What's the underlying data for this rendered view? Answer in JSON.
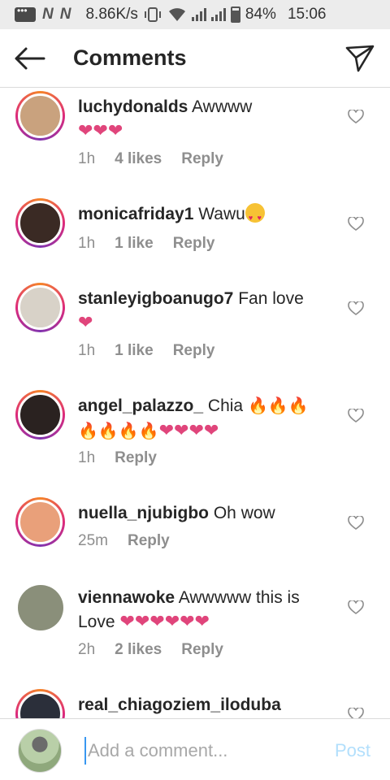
{
  "status_bar": {
    "n1": "N",
    "n2": "N",
    "speed": "8.86K/s",
    "battery": "84%",
    "time": "15:06"
  },
  "header": {
    "title": "Comments",
    "back_icon": "arrow-left-icon",
    "send_icon": "paper-plane-icon"
  },
  "comments": [
    {
      "username": "luchydonalds",
      "text": "Awwww",
      "emoji_line": "❤❤❤",
      "age": "1h",
      "likes": "4 likes",
      "reply": "Reply",
      "avatar_color": "#c9a27e"
    },
    {
      "username": "monicafriday1",
      "text": "Wawu",
      "age": "1h",
      "likes": "1 like",
      "reply": "Reply",
      "avatar_color": "#3a2a24"
    },
    {
      "username": "stanleyigboanugo7",
      "text": "Fan love",
      "emoji_line": "❤",
      "age": "1h",
      "likes": "1 like",
      "reply": "Reply",
      "avatar_color": "#d8d2c8"
    },
    {
      "username": "angel_palazzo_",
      "text": "Chia",
      "emoji_fire_1": "🔥🔥🔥",
      "emoji_fire_2": "🔥🔥🔥🔥",
      "emoji_hearts": "❤❤❤❤",
      "age": "1h",
      "reply": "Reply",
      "avatar_color": "#2a2220"
    },
    {
      "username": "nuella_njubigbo",
      "text": "Oh wow",
      "age": "25m",
      "reply": "Reply",
      "avatar_color": "#e9a07a"
    },
    {
      "username": "viennawoke",
      "text": "Awwwww this is",
      "text2": "Love",
      "emoji_line": "❤❤❤❤❤❤",
      "age": "2h",
      "likes": "2 likes",
      "reply": "Reply",
      "avatar_color": "#8a8f7a"
    },
    {
      "username": "real_chiagoziem_iloduba",
      "avatar_color": "#2b2f3a"
    }
  ],
  "input": {
    "placeholder": "Add a comment...",
    "post_label": "Post"
  },
  "colors": {
    "accent": "#3897f0",
    "heart": "#e0457b",
    "muted_text": "#8e8e8e",
    "post_disabled": "#b2dffc"
  }
}
